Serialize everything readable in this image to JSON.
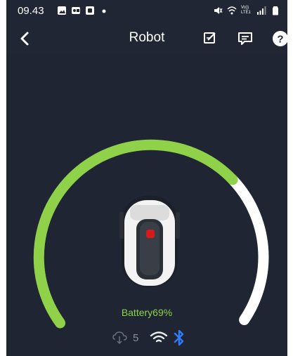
{
  "status_bar": {
    "time": "09.43",
    "signal": "Vo)) LTE1",
    "icons_left": [
      "image-icon",
      "scan-icon",
      "app-icon",
      "dot-icon"
    ],
    "icons_right": [
      "mute-icon",
      "wifi-icon",
      "lte-signal-icon",
      "battery-icon"
    ]
  },
  "app_bar": {
    "title": "Robot",
    "actions": [
      "edit-icon",
      "message-icon",
      "help-icon"
    ]
  },
  "gauge": {
    "battery_percent": 69,
    "battery_label": "Battery69%",
    "colors": {
      "filled": "#8fd149",
      "remaining": "#ffffff",
      "background": "#1f2532"
    }
  },
  "indicators": {
    "satellite_count": "5",
    "wifi_color": "#e8eaee",
    "bluetooth_color": "#2f7cf6"
  }
}
